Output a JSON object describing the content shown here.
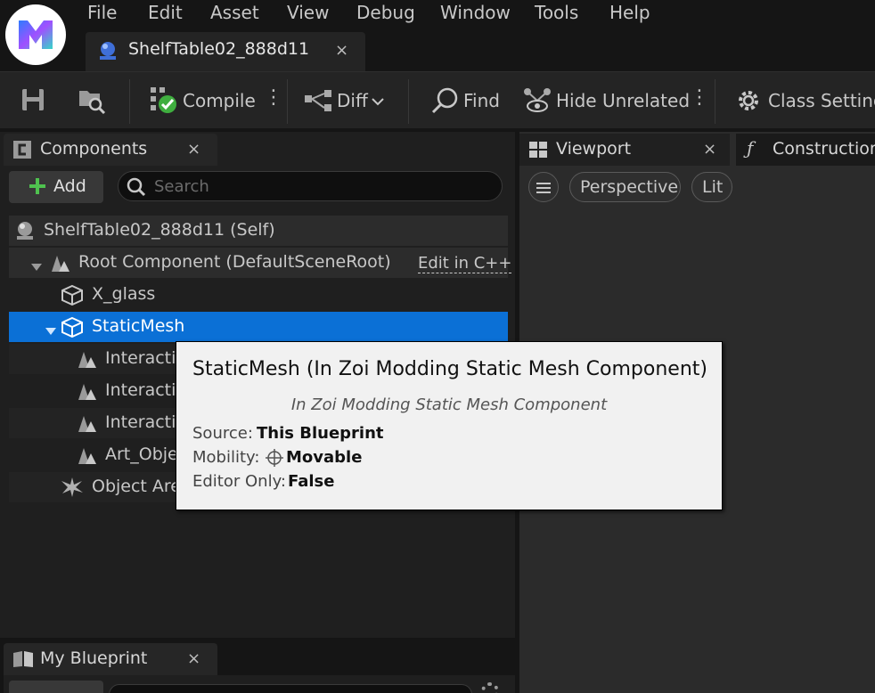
{
  "menu": {
    "items": [
      "File",
      "Edit",
      "Asset",
      "View",
      "Debug",
      "Window",
      "Tools",
      "Help"
    ]
  },
  "asset_tab": {
    "label": "ShelfTable02_888d11",
    "close": "×"
  },
  "toolbar": {
    "compile": "Compile",
    "diff": "Diff",
    "find": "Find",
    "hide_unrelated": "Hide Unrelated",
    "class_settings": "Class Settings"
  },
  "components_panel": {
    "tab_label": "Components",
    "close": "×",
    "add_label": "Add",
    "search_placeholder": "Search",
    "edit_cpp": "Edit in C++",
    "tree": [
      {
        "label": "ShelfTable02_888d11 (Self)",
        "icon": "actor-sphere-icon"
      },
      {
        "label": "Root Component (DefaultSceneRoot)",
        "icon": "scene-root-icon"
      },
      {
        "label": "X_glass",
        "icon": "cube-icon"
      },
      {
        "label": "StaticMesh",
        "icon": "cube-icon"
      },
      {
        "label": "Interactio",
        "icon": "scene-component-icon"
      },
      {
        "label": "Interactio",
        "icon": "scene-component-icon"
      },
      {
        "label": "Interactio",
        "icon": "scene-component-icon"
      },
      {
        "label": "Art_Obje",
        "icon": "scene-component-icon"
      },
      {
        "label": "Object Are",
        "icon": "burst-icon"
      }
    ]
  },
  "viewport_panel": {
    "tab_label": "Viewport",
    "close": "×",
    "construction_label": "Construction",
    "perspective": "Perspective",
    "lit": "Lit"
  },
  "blueprint_panel": {
    "tab_label": "My Blueprint",
    "close": "×"
  },
  "tooltip": {
    "title": "StaticMesh (In Zoi Modding Static Mesh Component)",
    "subtitle": "In Zoi Modding Static Mesh Component",
    "source_key": "Source:",
    "source_val": "This Blueprint",
    "mobility_key": "Mobility:",
    "mobility_val": "Movable",
    "editor_only_key": "Editor Only:",
    "editor_only_val": "False"
  },
  "colors": {
    "selection": "#0b70d6",
    "compile_ok": "#3fae3f",
    "add_plus": "#4fc24f"
  }
}
